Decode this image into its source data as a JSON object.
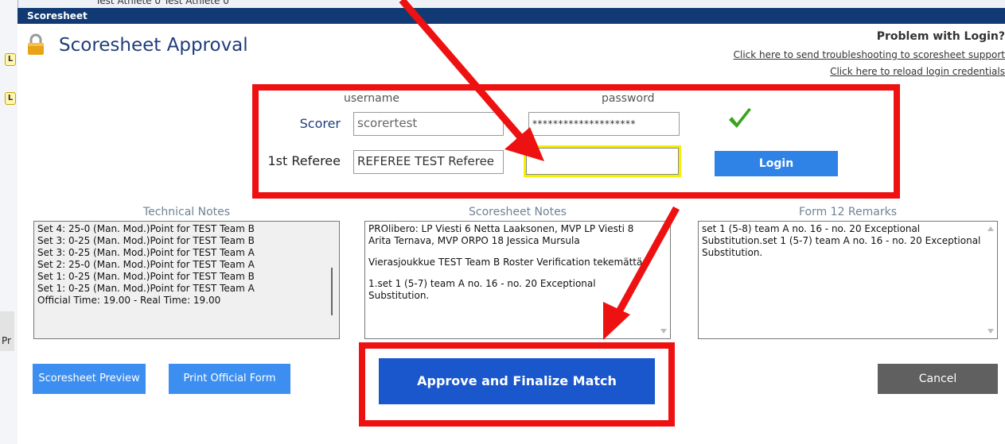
{
  "background": {
    "partial_text": "Test Athlete 0 Test Athlete 0",
    "left_badges": [
      "L",
      "L"
    ],
    "left_text": "Pr"
  },
  "window": {
    "title": "Scoresheet"
  },
  "header": {
    "title": "Scoresheet Approval",
    "problem_text": "Problem with Login?",
    "support_link": "Click here to send troubleshooting to scoresheet support",
    "reload_link": "Click here to reload login credentials",
    "icon": "lock-icon"
  },
  "login": {
    "username_label": "username",
    "password_label": "password",
    "scorer_label": "Scorer",
    "referee_label": "1st Referee",
    "scorer_username": "scorertest",
    "scorer_password": "********************",
    "referee_username": "REFEREE TEST Referee",
    "referee_password": "",
    "verified_icon": "check-icon",
    "login_button": "Login"
  },
  "notes": {
    "technical_title": "Technical Notes",
    "technical_lines": [
      "Set 4: 25-0 (Man. Mod.)Point for TEST Team B",
      "Set 3: 0-25 (Man. Mod.)Point for TEST Team B",
      "Set 3: 0-25 (Man. Mod.)Point for TEST Team A",
      "Set 2: 25-0 (Man. Mod.)Point for TEST Team A",
      "Set 1: 0-25 (Man. Mod.)Point for TEST Team B",
      "Set 1: 0-25 (Man. Mod.)Point for TEST Team A",
      "Official Time: 19.00  -  Real Time: 19.00"
    ],
    "scoresheet_title": "Scoresheet Notes",
    "scoresheet_paragraphs": [
      "PROlibero: LP Viesti 6 Netta Laaksonen, MVP LP Viesti 8 Arita Ternava, MVP ORPO 18 Jessica Mursula",
      "Vierasjoukkue TEST Team B Roster Verification tekemättä.",
      "1.set 1 (5-7) team A no. 16 - no. 20 Exceptional Substitution."
    ],
    "remarks_title": "Form 12 Remarks",
    "remarks_text": "set 1 (5-8) team A no. 16 - no. 20 Exceptional Substitution.set 1 (5-7) team A no. 16 - no. 20 Exceptional Substitution."
  },
  "actions": {
    "preview": "Scoresheet Preview",
    "print": "Print Official Form",
    "approve": "Approve and Finalize Match",
    "cancel": "Cancel"
  },
  "colors": {
    "titlebar": "#113a74",
    "heading": "#1f3d7a",
    "login_button": "#2f83e6",
    "approve_button": "#1a56cc",
    "cancel_button": "#606060",
    "annotation": "#ee1111",
    "focus_border": "#f5f000",
    "check": "#3aa41e",
    "lock": "#e8a317"
  }
}
